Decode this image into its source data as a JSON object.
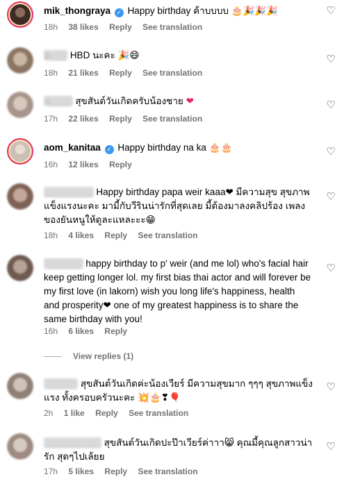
{
  "ui": {
    "like": "Like",
    "reply": "Reply",
    "see_translation": "See translation",
    "view_replies": "View replies (1)",
    "heart_icon": "♡"
  },
  "colors": {
    "meta_gray": "#737373",
    "verified_blue": "#3897f0",
    "heart_red": "#e0245e",
    "story_ring": "#e1306c"
  },
  "comments": [
    {
      "username": "mik_thongraya",
      "verified": true,
      "text": "Happy birthday ค้าบบบบ",
      "emoji": "🎂🎉🎉🎉",
      "time": "18h",
      "likes": "38 likes",
      "translation": "See translation"
    },
    {
      "username": "p___",
      "verified": false,
      "text": "HBD นะคะ",
      "emoji": "🎉😄",
      "time": "18h",
      "likes": "21 likes",
      "translation": "See translation"
    },
    {
      "username": "u____",
      "verified": false,
      "text": "สุขสันต์วันเกิดครับน้องชาย",
      "emoji": "❤",
      "time": "17h",
      "likes": "22 likes",
      "translation": "See translation"
    },
    {
      "username": "aom_kanitaa",
      "verified": true,
      "text": "Happy birthday na ka",
      "emoji": "🎂🎂",
      "time": "16h",
      "likes": "12 likes",
      "translation": ""
    },
    {
      "username": "_________",
      "verified": false,
      "text": "Happy birthday papa weir kaaa❤ มีความสุข สุขภาพแข็งแรงนะคะ มามี้กับวีรินน่ารักที่สุดเลย มี้ต้องมาลงคลิปร้อง เพลงของยันหนูให้ดูละแหละะะ😁",
      "emoji": "",
      "time": "18h",
      "likes": "4 likes",
      "translation": "See translation"
    },
    {
      "username": "_______",
      "verified": false,
      "text": "happy birthday to p' weir (and me lol) who's facial hair keep getting longer lol. my first bias thai actor and will forever be my first love (in lakorn) wish you long life's happiness, health and prosperity❤ one of my greatest happiness is to share the same birthday with you!",
      "emoji": "",
      "time": "16h",
      "likes": "6 likes",
      "translation": ""
    },
    {
      "username": "______",
      "verified": false,
      "text": "สุขสันต์วันเกิดค่ะน้องเวียร์ มีความสุขมาก ๆๆๆ สุขภาพแข็งแรง ทั้งครอบครัวนะคะ",
      "emoji": "💥🎂❣🎈",
      "time": "2h",
      "likes": "1 like",
      "translation": "See translation"
    },
    {
      "username": "_______ ___",
      "verified": false,
      "text": "สุขสันต์วันเกิดปะป๊าเวียร์ค่าาา😸 คุณมี้คุณลูกสาวน่ารัก สุดๆไปเล้ยย",
      "emoji": "",
      "time": "17h",
      "likes": "5 likes",
      "translation": "See translation"
    }
  ]
}
